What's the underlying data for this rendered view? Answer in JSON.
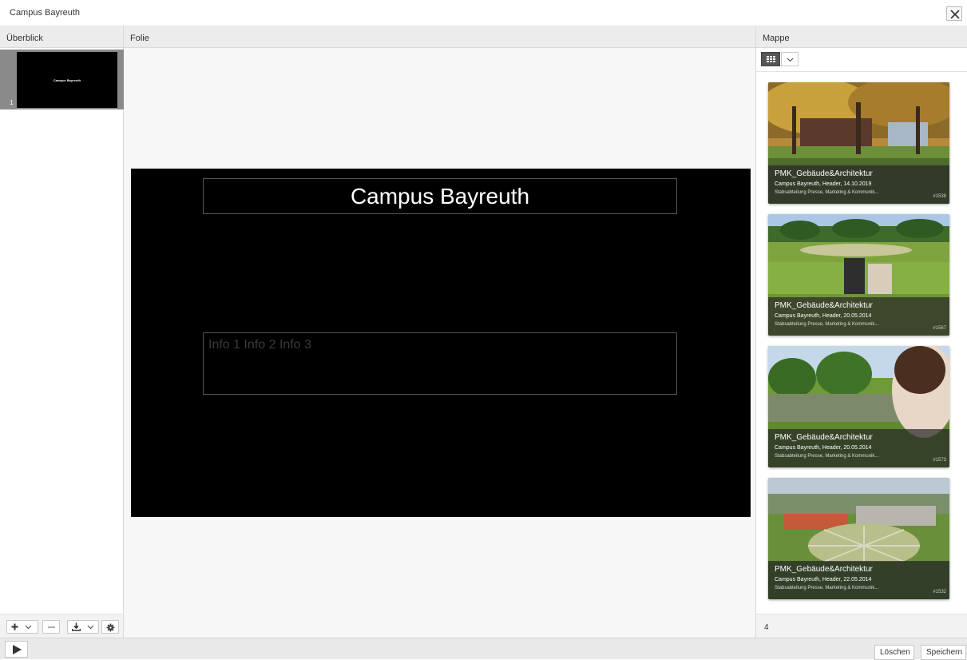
{
  "window": {
    "title": "Campus Bayreuth"
  },
  "columns": {
    "overview": "Überblick",
    "slide": "Folie",
    "folder": "Mappe"
  },
  "overview": {
    "slides": [
      {
        "number": "1",
        "title": "Campus Bayreuth"
      }
    ]
  },
  "slide": {
    "title": "Campus Bayreuth",
    "info": "Info 1 Info 2 Info 3"
  },
  "folder": {
    "count": "4",
    "items": [
      {
        "title": "PMK_Gebäude&Architektur",
        "subtitle": "Campus Bayreuth, Header, 14.10.2019",
        "org": "Stabsabteilung Presse, Marketing & Kommunik...",
        "id": "#1538"
      },
      {
        "title": "PMK_Gebäude&Architektur",
        "subtitle": "Campus Bayreuth, Header, 20.05.2014",
        "org": "Stabsabteilung Presse, Marketing & Kommunik...",
        "id": "#1567"
      },
      {
        "title": "PMK_Gebäude&Architektur",
        "subtitle": "Campus Bayreuth, Header, 20.05.2014",
        "org": "Stabsabteilung Presse, Marketing & Kommunik...",
        "id": "#1573"
      },
      {
        "title": "PMK_Gebäude&Architektur",
        "subtitle": "Campus Bayreuth, Header, 22.05.2014",
        "org": "Stabsabteilung Presse, Marketing & Kommunik...",
        "id": "#1532"
      }
    ]
  },
  "actions": {
    "delete": "Löschen",
    "save": "Speichern"
  },
  "icons": {
    "close": "close-icon",
    "add": "plus-icon",
    "remove": "minus-icon",
    "download": "download-icon",
    "settings": "gear-icon",
    "grid": "grid-icon",
    "dropdown": "chevron-down-icon",
    "play": "play-icon"
  }
}
